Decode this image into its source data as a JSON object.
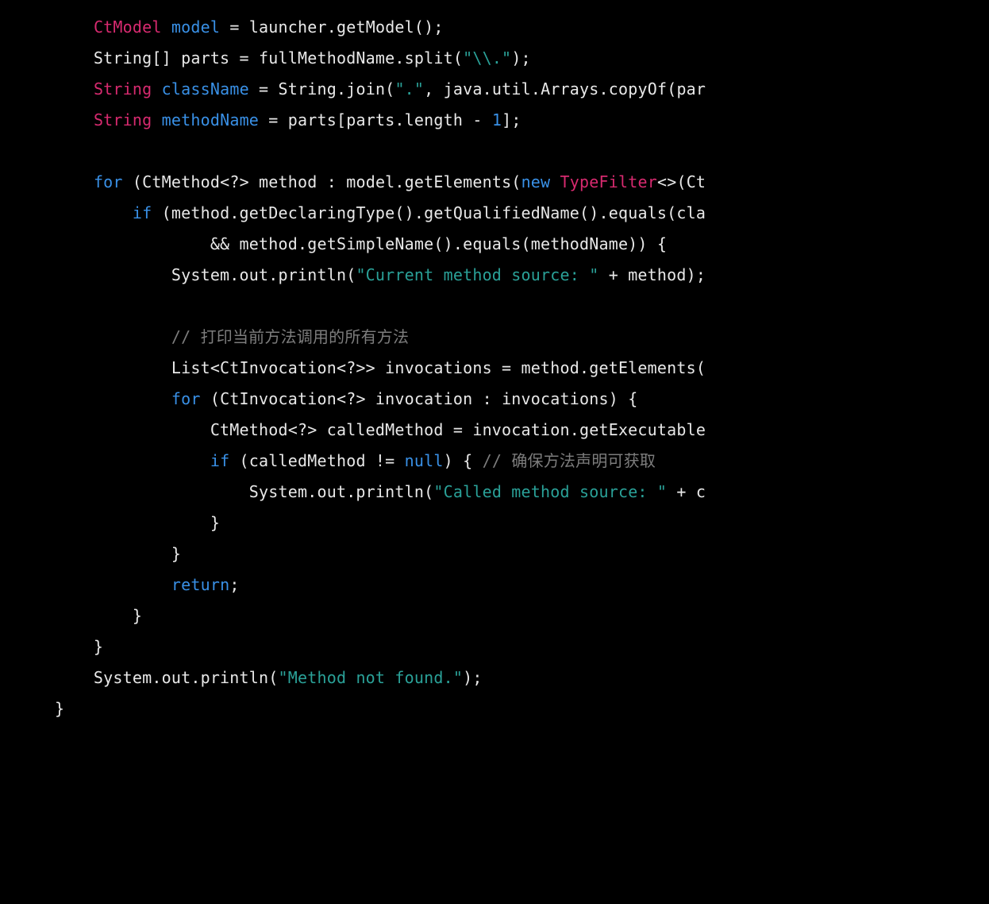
{
  "code": {
    "lines": [
      [
        {
          "cls": "tok-plain",
          "t": "        "
        },
        {
          "cls": "tok-type",
          "t": "CtModel"
        },
        {
          "cls": "tok-plain",
          "t": " "
        },
        {
          "cls": "tok-var",
          "t": "model"
        },
        {
          "cls": "tok-plain",
          "t": " = launcher.getModel();"
        }
      ],
      [
        {
          "cls": "tok-plain",
          "t": "        String[] parts = fullMethodName.split("
        },
        {
          "cls": "tok-str",
          "t": "\"\\\\.\""
        },
        {
          "cls": "tok-plain",
          "t": ");"
        }
      ],
      [
        {
          "cls": "tok-plain",
          "t": "        "
        },
        {
          "cls": "tok-type",
          "t": "String"
        },
        {
          "cls": "tok-plain",
          "t": " "
        },
        {
          "cls": "tok-var",
          "t": "className"
        },
        {
          "cls": "tok-plain",
          "t": " = String.join("
        },
        {
          "cls": "tok-str",
          "t": "\".\""
        },
        {
          "cls": "tok-plain",
          "t": ", java.util.Arrays.copyOf(par"
        }
      ],
      [
        {
          "cls": "tok-plain",
          "t": "        "
        },
        {
          "cls": "tok-type",
          "t": "String"
        },
        {
          "cls": "tok-plain",
          "t": " "
        },
        {
          "cls": "tok-var",
          "t": "methodName"
        },
        {
          "cls": "tok-plain",
          "t": " = parts[parts.length - "
        },
        {
          "cls": "tok-var",
          "t": "1"
        },
        {
          "cls": "tok-plain",
          "t": "];"
        }
      ],
      [
        {
          "cls": "tok-plain",
          "t": ""
        }
      ],
      [
        {
          "cls": "tok-plain",
          "t": "        "
        },
        {
          "cls": "tok-kw",
          "t": "for"
        },
        {
          "cls": "tok-plain",
          "t": " (CtMethod<?> method : model.getElements("
        },
        {
          "cls": "tok-var",
          "t": "new"
        },
        {
          "cls": "tok-plain",
          "t": " "
        },
        {
          "cls": "tok-type",
          "t": "TypeFilter"
        },
        {
          "cls": "tok-plain",
          "t": "<>(Ct"
        }
      ],
      [
        {
          "cls": "tok-plain",
          "t": "            "
        },
        {
          "cls": "tok-kw",
          "t": "if"
        },
        {
          "cls": "tok-plain",
          "t": " (method.getDeclaringType().getQualifiedName().equals(cla"
        }
      ],
      [
        {
          "cls": "tok-plain",
          "t": "                    && method.getSimpleName().equals(methodName)) {"
        }
      ],
      [
        {
          "cls": "tok-plain",
          "t": "                System.out.println("
        },
        {
          "cls": "tok-str",
          "t": "\"Current method source: \""
        },
        {
          "cls": "tok-plain",
          "t": " + method);"
        }
      ],
      [
        {
          "cls": "tok-plain",
          "t": ""
        }
      ],
      [
        {
          "cls": "tok-plain",
          "t": "                "
        },
        {
          "cls": "tok-cmt",
          "t": "// 打印当前方法调用的所有方法"
        }
      ],
      [
        {
          "cls": "tok-plain",
          "t": "                List<CtInvocation<?>> invocations = method.getElements("
        }
      ],
      [
        {
          "cls": "tok-plain",
          "t": "                "
        },
        {
          "cls": "tok-kw",
          "t": "for"
        },
        {
          "cls": "tok-plain",
          "t": " (CtInvocation<?> invocation : invocations) {"
        }
      ],
      [
        {
          "cls": "tok-plain",
          "t": "                    CtMethod<?> calledMethod = invocation.getExecutable"
        }
      ],
      [
        {
          "cls": "tok-plain",
          "t": "                    "
        },
        {
          "cls": "tok-kw",
          "t": "if"
        },
        {
          "cls": "tok-plain",
          "t": " (calledMethod != "
        },
        {
          "cls": "tok-var",
          "t": "null"
        },
        {
          "cls": "tok-plain",
          "t": ") { "
        },
        {
          "cls": "tok-cmt",
          "t": "// 确保方法声明可获取"
        }
      ],
      [
        {
          "cls": "tok-plain",
          "t": "                        System.out.println("
        },
        {
          "cls": "tok-str",
          "t": "\"Called method source: \""
        },
        {
          "cls": "tok-plain",
          "t": " + c"
        }
      ],
      [
        {
          "cls": "tok-plain",
          "t": "                    }"
        }
      ],
      [
        {
          "cls": "tok-plain",
          "t": "                }"
        }
      ],
      [
        {
          "cls": "tok-plain",
          "t": "                "
        },
        {
          "cls": "tok-kw",
          "t": "return"
        },
        {
          "cls": "tok-plain",
          "t": ";"
        }
      ],
      [
        {
          "cls": "tok-plain",
          "t": "            }"
        }
      ],
      [
        {
          "cls": "tok-plain",
          "t": "        }"
        }
      ],
      [
        {
          "cls": "tok-plain",
          "t": "        System.out.println("
        },
        {
          "cls": "tok-str",
          "t": "\"Method not found.\""
        },
        {
          "cls": "tok-plain",
          "t": ");"
        }
      ],
      [
        {
          "cls": "tok-plain",
          "t": "    }"
        }
      ]
    ]
  }
}
